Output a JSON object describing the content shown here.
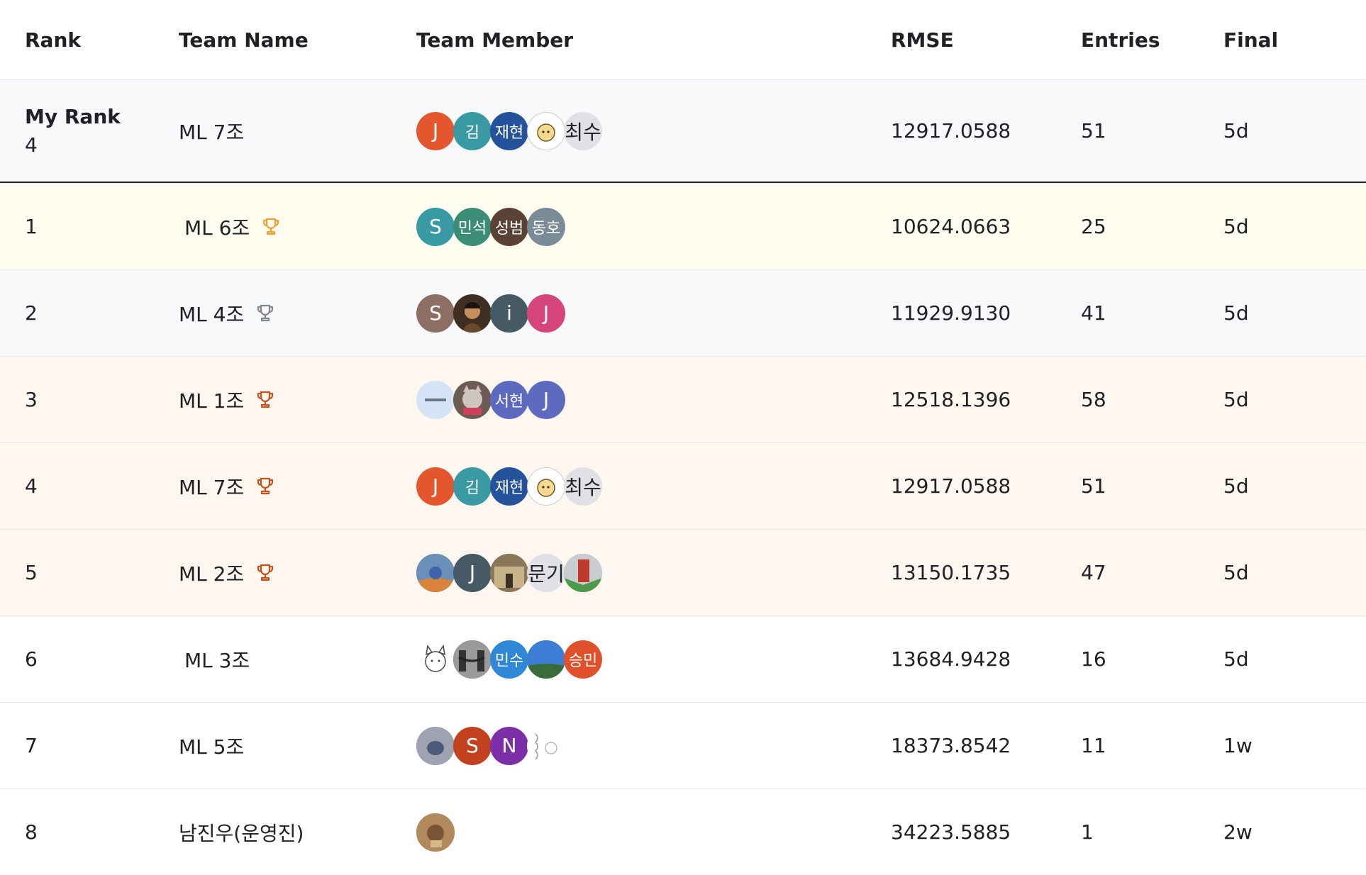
{
  "headers": {
    "rank": "Rank",
    "team": "Team Name",
    "members": "Team Member",
    "score": "RMSE",
    "entries": "Entries",
    "final": "Final"
  },
  "my_rank": {
    "label": "My Rank",
    "rank": "4",
    "team": "ML 7조",
    "score": "12917.0588",
    "entries": "51",
    "final": "5d"
  },
  "rows": [
    {
      "rank": "1",
      "team": "ML 6조",
      "score": "10624.0663",
      "entries": "25",
      "final": "5d",
      "medal": "gold"
    },
    {
      "rank": "2",
      "team": "ML 4조",
      "score": "11929.9130",
      "entries": "41",
      "final": "5d",
      "medal": "silver"
    },
    {
      "rank": "3",
      "team": "ML 1조",
      "score": "12518.1396",
      "entries": "58",
      "final": "5d",
      "medal": "bronze"
    },
    {
      "rank": "4",
      "team": "ML 7조",
      "score": "12917.0588",
      "entries": "51",
      "final": "5d",
      "medal": "bronze"
    },
    {
      "rank": "5",
      "team": "ML 2조",
      "score": "13150.1735",
      "entries": "47",
      "final": "5d",
      "medal": "bronze"
    },
    {
      "rank": "6",
      "team": "ML 3조",
      "score": "13684.9428",
      "entries": "16",
      "final": "5d",
      "medal": "none"
    },
    {
      "rank": "7",
      "team": "ML 5조",
      "score": "18373.8542",
      "entries": "11",
      "final": "1w",
      "medal": "none"
    },
    {
      "rank": "8",
      "team": "남진우(운영진)",
      "score": "34223.5885",
      "entries": "1",
      "final": "2w",
      "medal": "none"
    }
  ],
  "avatars": {
    "team7": [
      "J",
      "김",
      "재현",
      "",
      "최수"
    ],
    "team6": [
      "S",
      "민석",
      "성범",
      "동호"
    ],
    "team4": [
      "S",
      "",
      "i",
      "J"
    ],
    "team1": [
      "",
      "",
      "서현",
      "J"
    ],
    "team2": [
      "",
      "J",
      "",
      "문기",
      ""
    ],
    "team3": [
      "",
      "",
      "민수",
      "",
      "승민"
    ],
    "team5": [
      "",
      "S",
      "N",
      ""
    ],
    "staff": [
      ""
    ]
  },
  "colors": {
    "gold_row": "#fefdf0",
    "silver_row": "#f8f9fb",
    "bronze_row": "#fef7ef",
    "gold_trophy": "#f0a030",
    "silver_trophy": "#80868b",
    "bronze_trophy": "#c2531d"
  },
  "icons": {
    "trophy": "trophy-icon"
  }
}
